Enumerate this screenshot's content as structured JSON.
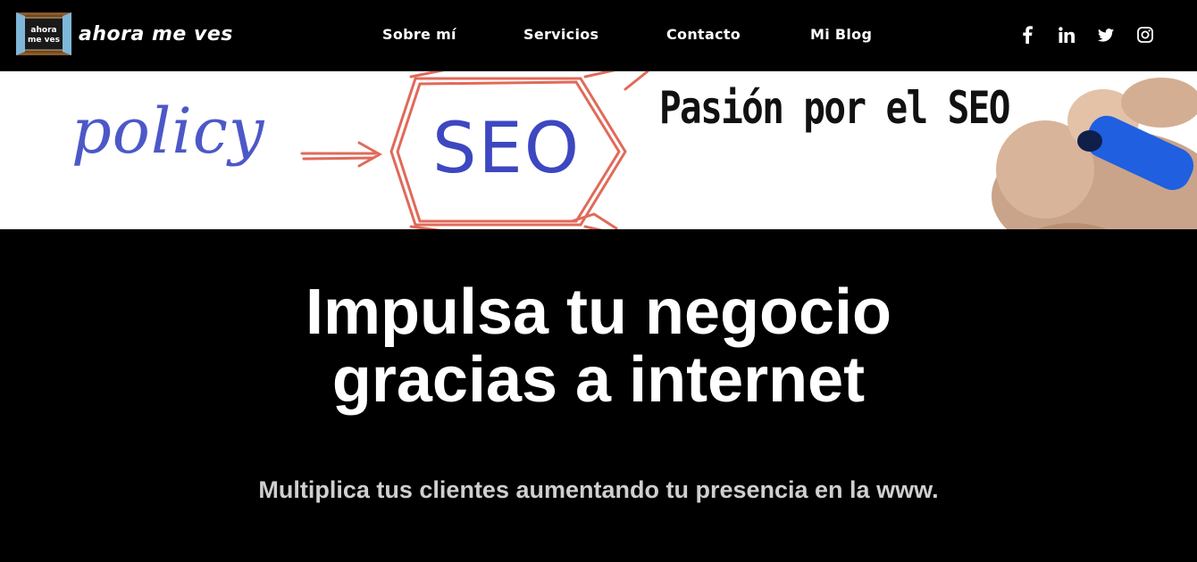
{
  "brand": {
    "name": "ahora me ves",
    "window_text_top": "ahora",
    "window_text_bottom": "me ves"
  },
  "nav": [
    {
      "label": "Sobre mí"
    },
    {
      "label": "Servicios"
    },
    {
      "label": "Contacto"
    },
    {
      "label": "Mi Blog"
    }
  ],
  "social": [
    {
      "icon": "facebook-icon"
    },
    {
      "icon": "linkedin-icon"
    },
    {
      "icon": "twitter-icon"
    },
    {
      "icon": "instagram-icon"
    }
  ],
  "banner": {
    "word_left": "policy",
    "word_center": "SEO",
    "headline": "Pasión por el SEO"
  },
  "hero": {
    "title_line1": "Impulsa tu negocio",
    "title_line2": "gracias a internet",
    "subtitle": "Multiplica tus clientes aumentando tu presencia en la www."
  },
  "colors": {
    "background": "#000000",
    "banner_blue": "#4453c9",
    "banner_red": "#e06a5a",
    "pen_blue": "#1f5fe0"
  }
}
